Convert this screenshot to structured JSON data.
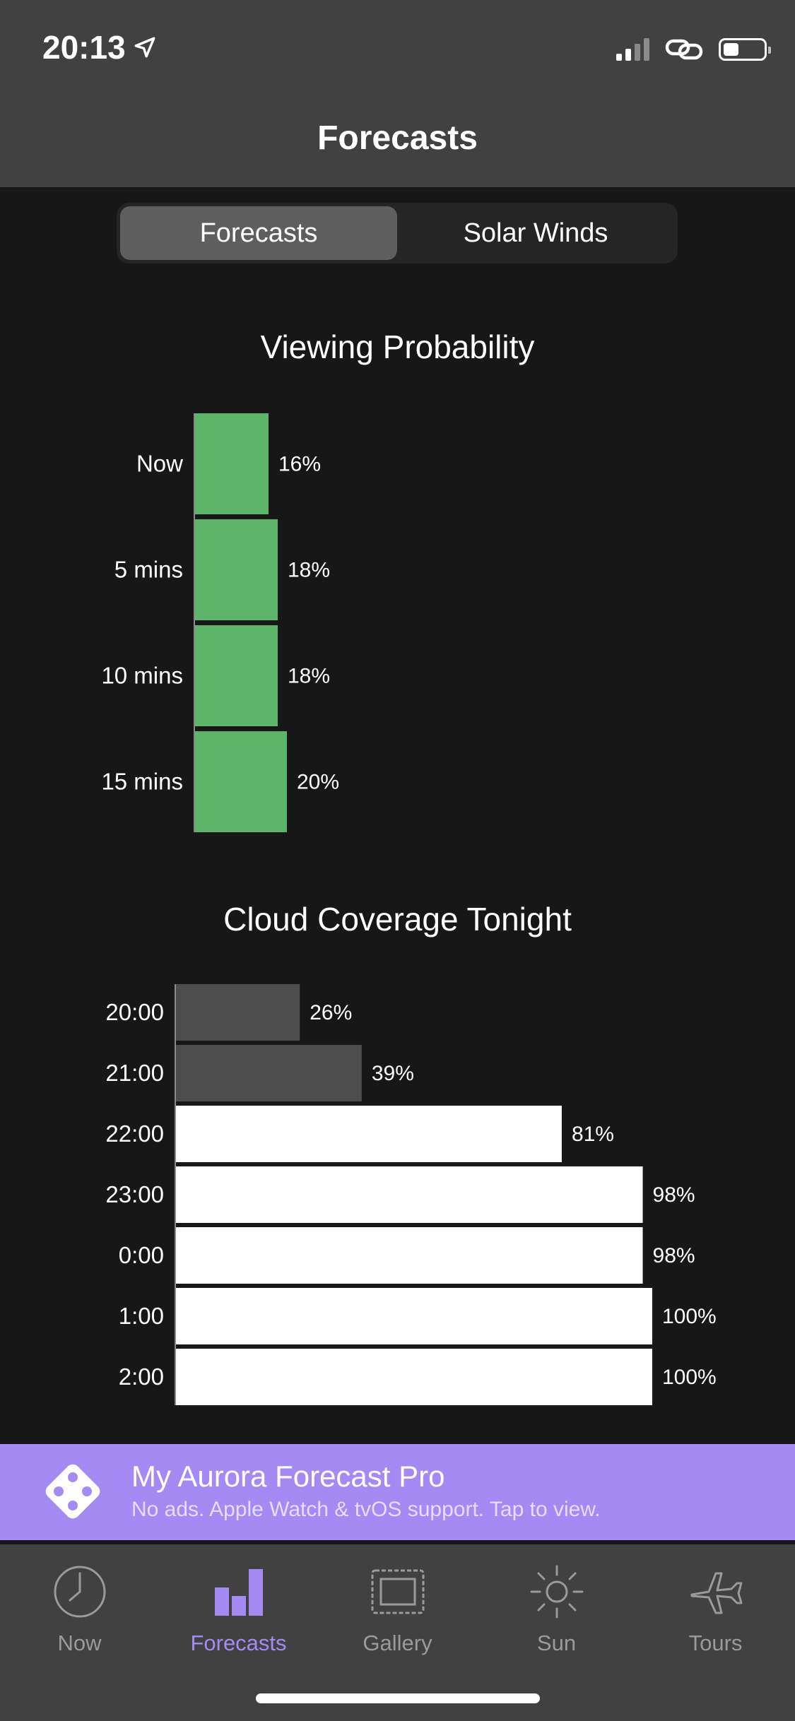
{
  "status_bar": {
    "time": "20:13"
  },
  "nav": {
    "title": "Forecasts"
  },
  "segmented": {
    "options": [
      "Forecasts",
      "Solar Winds"
    ],
    "selected": "Forecasts"
  },
  "colors": {
    "accent": "#a58af4",
    "probability_bar": "#5db56b",
    "cloud_low": "#4d4d4d",
    "cloud_high": "#ffffff"
  },
  "viewing_probability": {
    "title": "Viewing Probability",
    "chart_data": {
      "type": "bar",
      "orientation": "horizontal",
      "categories": [
        "Now",
        "5 mins",
        "10 mins",
        "15 mins"
      ],
      "values": [
        16,
        18,
        18,
        20
      ],
      "value_labels": [
        "16%",
        "18%",
        "18%",
        "20%"
      ],
      "xlim": [
        0,
        100
      ],
      "unit": "%"
    }
  },
  "cloud_coverage": {
    "title": "Cloud Coverage Tonight",
    "chart_data": {
      "type": "bar",
      "orientation": "horizontal",
      "categories": [
        "20:00",
        "21:00",
        "22:00",
        "23:00",
        "0:00",
        "1:00",
        "2:00"
      ],
      "values": [
        26,
        39,
        81,
        98,
        98,
        100,
        100
      ],
      "value_labels": [
        "26%",
        "39%",
        "81%",
        "98%",
        "98%",
        "100%",
        "100%"
      ],
      "xlim": [
        0,
        100
      ],
      "unit": "%"
    }
  },
  "promo": {
    "title": "My Aurora Forecast Pro",
    "subtitle": "No ads. Apple Watch & tvOS support. Tap to view."
  },
  "tabs": [
    {
      "label": "Now",
      "icon": "clock-icon"
    },
    {
      "label": "Forecasts",
      "icon": "bar-chart-icon"
    },
    {
      "label": "Gallery",
      "icon": "picture-frame-icon"
    },
    {
      "label": "Sun",
      "icon": "sun-icon"
    },
    {
      "label": "Tours",
      "icon": "airplane-icon"
    }
  ],
  "active_tab": "Forecasts"
}
